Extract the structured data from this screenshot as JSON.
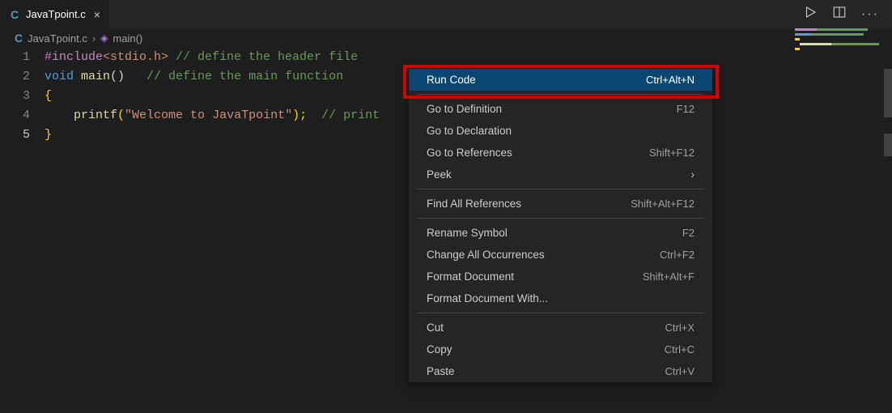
{
  "tab": {
    "filename": "JavaTpoint.c"
  },
  "breadcrumb": {
    "file": "JavaTpoint.c",
    "symbol": "main()"
  },
  "lines": [
    "1",
    "2",
    "3",
    "4",
    "5"
  ],
  "code": {
    "l1": {
      "macro": "#include",
      "inc": "<stdio.h>",
      "comment": " // define the header file"
    },
    "l2": {
      "kw1": "void",
      "fn": " main",
      "paren": "()   ",
      "comment": "// define the main function"
    },
    "l3": {
      "brace": "{"
    },
    "l4": {
      "indent": "    ",
      "fn": "printf",
      "po": "(",
      "str": "\"Welcome to JavaTpoint\"",
      "pc": ");  ",
      "comment": "// print"
    },
    "l5": {
      "brace": "}"
    }
  },
  "menu": {
    "items": [
      {
        "label": "Run Code",
        "kb": "Ctrl+Alt+N",
        "selected": true
      },
      {
        "sep": true
      },
      {
        "label": "Go to Definition",
        "kb": "F12"
      },
      {
        "label": "Go to Declaration",
        "kb": ""
      },
      {
        "label": "Go to References",
        "kb": "Shift+F12"
      },
      {
        "label": "Peek",
        "submenu": true
      },
      {
        "sep": true
      },
      {
        "label": "Find All References",
        "kb": "Shift+Alt+F12"
      },
      {
        "sep": true
      },
      {
        "label": "Rename Symbol",
        "kb": "F2"
      },
      {
        "label": "Change All Occurrences",
        "kb": "Ctrl+F2"
      },
      {
        "label": "Format Document",
        "kb": "Shift+Alt+F"
      },
      {
        "label": "Format Document With...",
        "kb": ""
      },
      {
        "sep": true
      },
      {
        "label": "Cut",
        "kb": "Ctrl+X"
      },
      {
        "label": "Copy",
        "kb": "Ctrl+C"
      },
      {
        "label": "Paste",
        "kb": "Ctrl+V"
      }
    ]
  }
}
